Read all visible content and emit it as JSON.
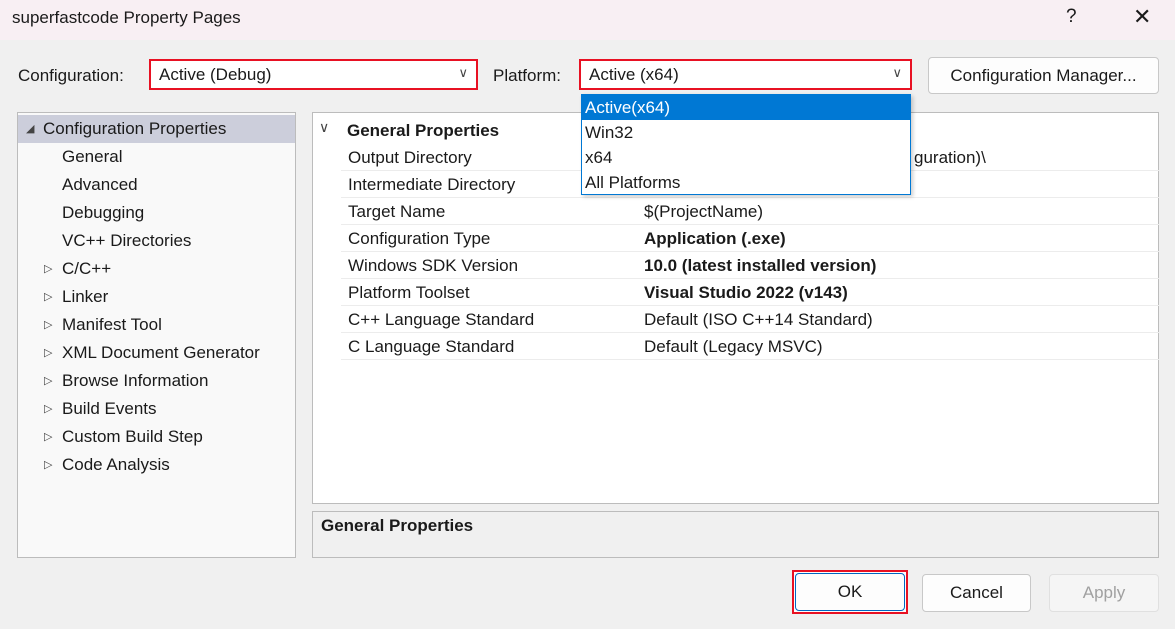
{
  "window": {
    "title": "superfastcode Property Pages",
    "help": "?",
    "close": "✕"
  },
  "config": {
    "label": "Configuration:",
    "value": "Active (Debug)"
  },
  "platform": {
    "label": "Platform:",
    "value": "Active (x64)",
    "options": [
      "Active(x64)",
      "Win32",
      "x64",
      "All Platforms"
    ],
    "selected": "Active(x64)"
  },
  "config_manager": "Configuration Manager...",
  "tree": {
    "root": "Configuration Properties",
    "children": [
      "General",
      "Advanced",
      "Debugging",
      "VC++ Directories"
    ],
    "expandable": [
      "C/C++",
      "Linker",
      "Manifest Tool",
      "XML Document Generator",
      "Browse Information",
      "Build Events",
      "Custom Build Step",
      "Code Analysis"
    ]
  },
  "grid": {
    "section": "General Properties",
    "rows": [
      {
        "name": "Output Directory",
        "value": "guration)\\",
        "bold": false
      },
      {
        "name": "Intermediate Directory",
        "value": "",
        "bold": false
      },
      {
        "name": "Target Name",
        "value": "$(ProjectName)",
        "bold": false
      },
      {
        "name": "Configuration Type",
        "value": "Application (.exe)",
        "bold": true
      },
      {
        "name": "Windows SDK Version",
        "value": "10.0 (latest installed version)",
        "bold": true
      },
      {
        "name": "Platform Toolset",
        "value": "Visual Studio 2022 (v143)",
        "bold": true
      },
      {
        "name": "C++ Language Standard",
        "value": "Default (ISO C++14 Standard)",
        "bold": false
      },
      {
        "name": "C Language Standard",
        "value": "Default (Legacy MSVC)",
        "bold": false
      }
    ]
  },
  "description": "General Properties",
  "buttons": {
    "ok": "OK",
    "cancel": "Cancel",
    "apply": "Apply"
  },
  "colors": {
    "highlight": "#e81123",
    "accent": "#0078d4",
    "tree_selected": "#cccedb"
  }
}
